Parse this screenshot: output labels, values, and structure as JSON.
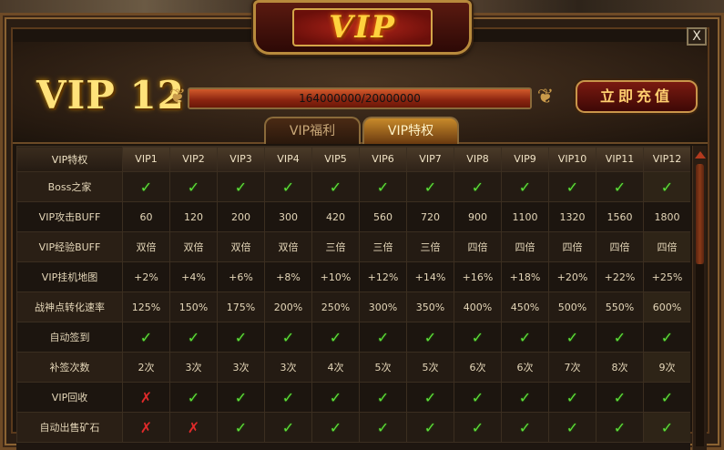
{
  "window": {
    "title": "VIP",
    "close_label": "X"
  },
  "status": {
    "level_label": "VIP 12",
    "progress_text": "164000000/20000000",
    "progress_fraction": 1.0
  },
  "actions": {
    "recharge_label": "立即充值"
  },
  "tabs": [
    {
      "label": "VIP福利",
      "active": false
    },
    {
      "label": "VIP特权",
      "active": true
    }
  ],
  "table": {
    "corner_header": "VIP特权",
    "columns": [
      "VIP1",
      "VIP2",
      "VIP3",
      "VIP4",
      "VIP5",
      "VIP6",
      "VIP7",
      "VIP8",
      "VIP9",
      "VIP10",
      "VIP11",
      "VIP12"
    ],
    "rows": [
      {
        "label": "Boss之家",
        "cells": [
          "check",
          "check",
          "check",
          "check",
          "check",
          "check",
          "check",
          "check",
          "check",
          "check",
          "check",
          "check"
        ]
      },
      {
        "label": "VIP攻击BUFF",
        "cells": [
          "60",
          "120",
          "200",
          "300",
          "420",
          "560",
          "720",
          "900",
          "1100",
          "1320",
          "1560",
          "1800"
        ]
      },
      {
        "label": "VIP经验BUFF",
        "cells": [
          "双倍",
          "双倍",
          "双倍",
          "双倍",
          "三倍",
          "三倍",
          "三倍",
          "四倍",
          "四倍",
          "四倍",
          "四倍",
          "四倍"
        ]
      },
      {
        "label": "VIP挂机地图",
        "cells": [
          "+2%",
          "+4%",
          "+6%",
          "+8%",
          "+10%",
          "+12%",
          "+14%",
          "+16%",
          "+18%",
          "+20%",
          "+22%",
          "+25%"
        ]
      },
      {
        "label": "战神点转化速率",
        "cells": [
          "125%",
          "150%",
          "175%",
          "200%",
          "250%",
          "300%",
          "350%",
          "400%",
          "450%",
          "500%",
          "550%",
          "600%"
        ]
      },
      {
        "label": "自动签到",
        "cells": [
          "check",
          "check",
          "check",
          "check",
          "check",
          "check",
          "check",
          "check",
          "check",
          "check",
          "check",
          "check"
        ]
      },
      {
        "label": "补签次数",
        "cells": [
          "2次",
          "3次",
          "3次",
          "3次",
          "4次",
          "5次",
          "5次",
          "6次",
          "6次",
          "7次",
          "8次",
          "9次"
        ]
      },
      {
        "label": "VIP回收",
        "cells": [
          "cross",
          "check",
          "check",
          "check",
          "check",
          "check",
          "check",
          "check",
          "check",
          "check",
          "check",
          "check"
        ]
      },
      {
        "label": "自动出售矿石",
        "cells": [
          "cross",
          "cross",
          "check",
          "check",
          "check",
          "check",
          "check",
          "check",
          "check",
          "check",
          "check",
          "check"
        ]
      }
    ]
  },
  "icons": {
    "check": "✓",
    "cross": "✗"
  },
  "colors": {
    "check": "#5fdc3a",
    "cross": "#e02a2a",
    "gold": "#ffd23e"
  }
}
